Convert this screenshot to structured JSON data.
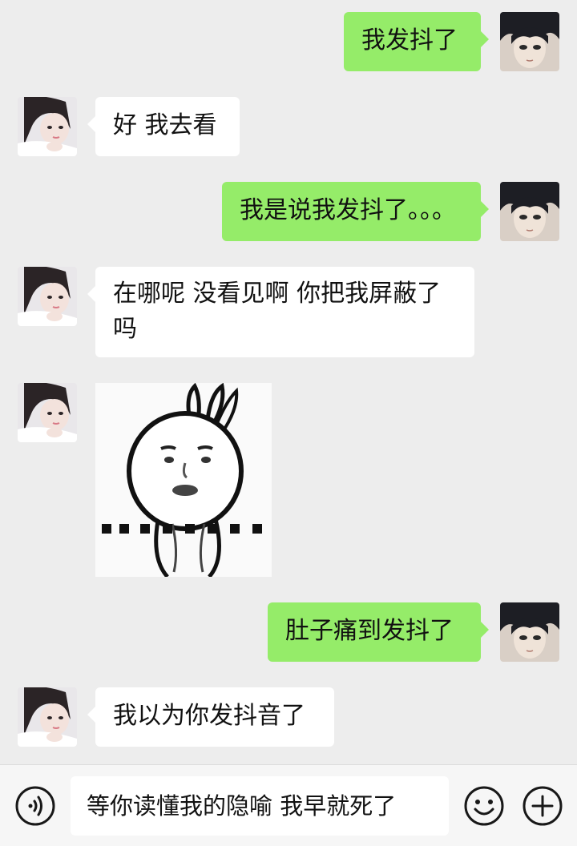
{
  "messages": [
    {
      "side": "right",
      "text": "我发抖了"
    },
    {
      "side": "left",
      "text": "好 我去看"
    },
    {
      "side": "right",
      "text": "我是说我发抖了。。。"
    },
    {
      "side": "left",
      "text": "在哪呢 没看见啊 你把我屏蔽了吗"
    },
    {
      "side": "left",
      "type": "sticker"
    },
    {
      "side": "right",
      "text": "肚子痛到发抖了"
    },
    {
      "side": "left",
      "text": "我以为你发抖音了"
    }
  ],
  "input_bar": {
    "text": "等你读懂我的隐喻 我早就死了",
    "left_icon": "voice-icon",
    "right_icons": [
      "emoji-icon",
      "plus-icon"
    ]
  },
  "colors": {
    "background": "#ededed",
    "sent_bubble": "#95ec69",
    "received_bubble": "#ffffff"
  }
}
